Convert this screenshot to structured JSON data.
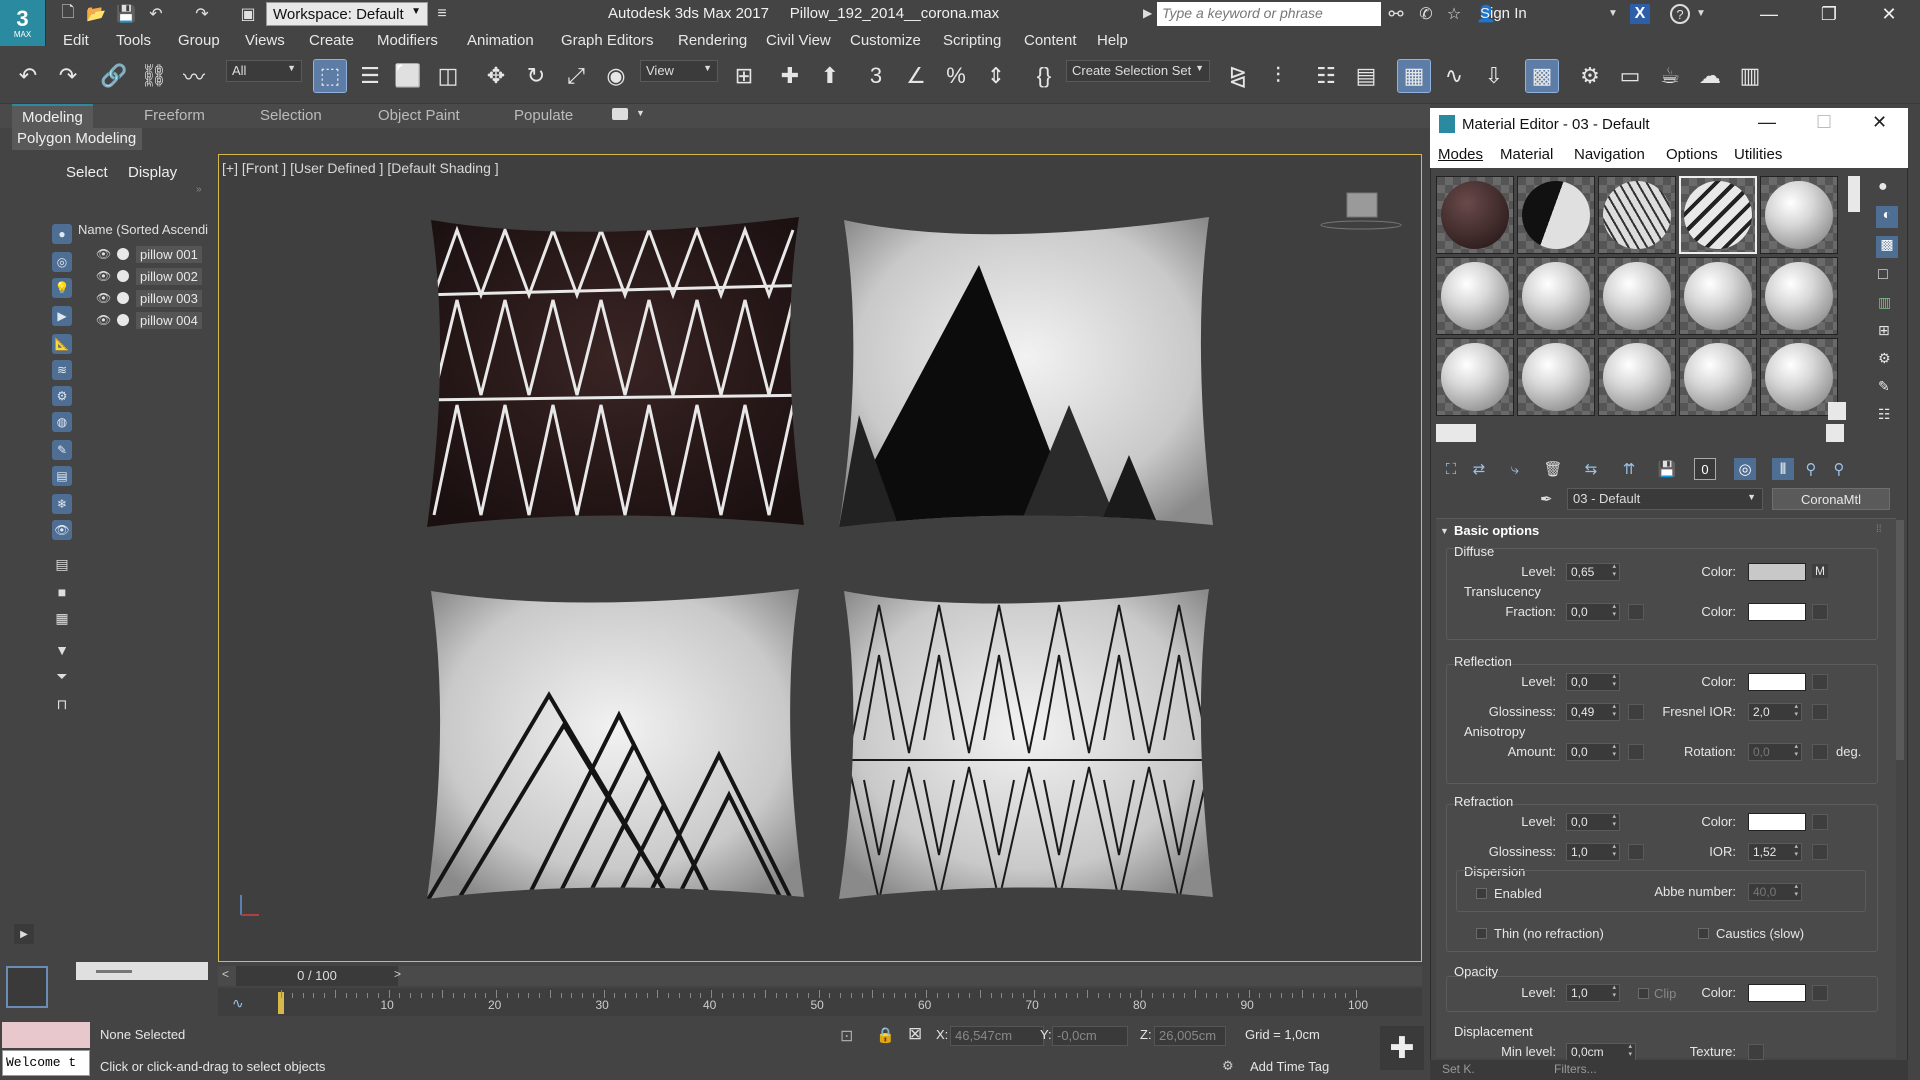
{
  "app": {
    "logo_number": "3",
    "logo_sub": "MAX",
    "workspace": "Workspace: Default",
    "title": "Autodesk 3ds Max 2017",
    "filename": "Pillow_192_2014__corona.max",
    "search_placeholder": "Type a keyword or phrase",
    "sign_in": "Sign In"
  },
  "menu": [
    "Edit",
    "Tools",
    "Group",
    "Views",
    "Create",
    "Modifiers",
    "Animation",
    "Graph Editors",
    "Rendering",
    "Civil View",
    "Customize",
    "Scripting",
    "Content",
    "Help"
  ],
  "toolbar": {
    "filter": "All",
    "ref_coord": "View",
    "selection_set": "Create Selection Set"
  },
  "ribbon": {
    "tabs": [
      "Modeling",
      "Freeform",
      "Selection",
      "Object Paint",
      "Populate"
    ],
    "active": "Modeling",
    "panel": "Polygon Modeling"
  },
  "explorer": {
    "tabs": [
      "Select",
      "Display"
    ],
    "header": "Name (Sorted Ascendi",
    "items": [
      "pillow 001",
      "pillow 002",
      "pillow 003",
      "pillow 004"
    ]
  },
  "viewport": {
    "label": "[+] [Front ] [User Defined ] [Default Shading ]"
  },
  "timeline": {
    "frame": "0 / 100",
    "ticks": [
      "10",
      "20",
      "30",
      "40",
      "50",
      "60",
      "70",
      "80",
      "90",
      "100"
    ]
  },
  "status": {
    "welcome": "Welcome t",
    "selection": "None Selected",
    "prompt": "Click or click-and-drag to select objects",
    "x_label": "X:",
    "x": "46,547cm",
    "y_label": "Y:",
    "y": "-0,0cm",
    "z_label": "Z:",
    "z": "26,005cm",
    "grid": "Grid = 1,0cm",
    "add_time_tag": "Add Time Tag",
    "set_k": "Set K.",
    "filters": "Filters..."
  },
  "material_editor": {
    "title": "Material Editor - 03 - Default",
    "menu": [
      "Modes",
      "Material",
      "Navigation",
      "Options",
      "Utilities"
    ],
    "material_name": "03 - Default",
    "material_type": "CoronaMtl",
    "rollout_title": "Basic options",
    "diffuse": {
      "label": "Diffuse",
      "level_label": "Level:",
      "level": "0,65",
      "color_label": "Color:",
      "map_flag": "M",
      "color": "#c8c8c8"
    },
    "translucency": {
      "label": "Translucency",
      "fraction_label": "Fraction:",
      "fraction": "0,0",
      "color_label": "Color:"
    },
    "reflection": {
      "label": "Reflection",
      "level_label": "Level:",
      "level": "0,0",
      "color_label": "Color:",
      "glossiness_label": "Glossiness:",
      "glossiness": "0,49",
      "fresnel_label": "Fresnel IOR:",
      "fresnel": "2,0"
    },
    "anisotropy": {
      "label": "Anisotropy",
      "amount_label": "Amount:",
      "amount": "0,0",
      "rotation_label": "Rotation:",
      "rotation": "0,0",
      "unit": "deg."
    },
    "refraction": {
      "label": "Refraction",
      "level_label": "Level:",
      "level": "0,0",
      "color_label": "Color:",
      "glossiness_label": "Glossiness:",
      "glossiness": "1,0",
      "ior_label": "IOR:",
      "ior": "1,52"
    },
    "dispersion": {
      "label": "Dispersion",
      "enabled_label": "Enabled",
      "abbe_label": "Abbe number:",
      "abbe": "40,0"
    },
    "thin_label": "Thin (no refraction)",
    "caustics_label": "Caustics (slow)",
    "opacity": {
      "label": "Opacity",
      "level_label": "Level:",
      "level": "1,0",
      "clip_label": "Clip",
      "color_label": "Color:"
    },
    "displacement": {
      "label": "Displacement",
      "min_label": "Min level:",
      "min": "0,0cm",
      "texture_label": "Texture:"
    }
  }
}
